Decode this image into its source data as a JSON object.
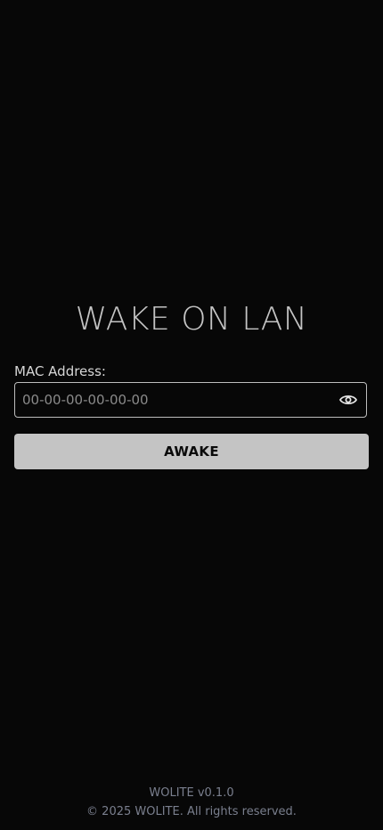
{
  "header": {
    "title": "WAKE ON LAN"
  },
  "form": {
    "mac_label": "MAC Address:",
    "mac_value": "",
    "mac_placeholder": "00-00-00-00-00-00",
    "visibility_icon": "eye-icon",
    "submit_label": "AWAKE"
  },
  "footer": {
    "version": "WOLITE v0.1.0",
    "copyright": "© 2025 WOLITE. All rights reserved."
  },
  "colors": {
    "background": "#070707",
    "title": "#c4c4c4",
    "button_bg": "#c4c4c4",
    "button_text": "#0a0a0a",
    "footer_text": "#7a7f8e"
  }
}
